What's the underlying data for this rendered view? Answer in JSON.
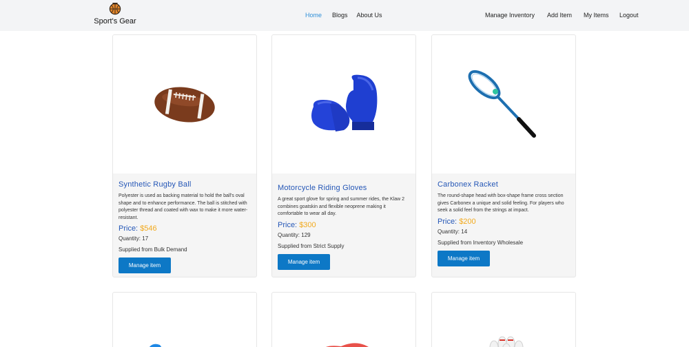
{
  "brand": {
    "name": "Sport's Gear"
  },
  "nav": {
    "center": [
      {
        "label": "Home",
        "active": true
      },
      {
        "label": "Blogs",
        "active": false
      },
      {
        "label": "About Us",
        "active": false
      }
    ],
    "right": [
      {
        "label": "Manage Inventory"
      },
      {
        "label": "Add Item"
      },
      {
        "label": "My Items"
      },
      {
        "label": "Logout"
      }
    ]
  },
  "colors": {
    "accent": "#0d78c6",
    "title": "#2456b6",
    "price": "#f2a91c",
    "nav_active": "#2f8fd8",
    "navbar_bg": "#f3f4f6"
  },
  "products": [
    {
      "name": "Synthetic Rugby Ball",
      "image_icon": "rugby-ball-image",
      "description": "Polyester is used as backing material to hold the ball's oval shape and to enhance performance. The ball is stitched with polyester thread and coated with wax to make it more water-resistant.",
      "price_label": "Price:",
      "price": "$546",
      "quantity": "Quantity: 17",
      "supplier": "Supplied from Bulk Demand",
      "button": "Manage item"
    },
    {
      "name": "Motorcycle Riding Gloves",
      "image_icon": "boxing-gloves-image",
      "description": "A great sport glove for spring and summer rides, the Klaw 2 combines goatskin and flexible neoprene making it comfortable to wear all day.",
      "price_label": "Price:",
      "price": "$300",
      "quantity": "Quantity: 129",
      "supplier": "Supplied from Strict Supply",
      "button": "Manage item"
    },
    {
      "name": "Carbonex Racket",
      "image_icon": "tennis-racket-image",
      "description": "The round-shape head with box-shape frame cross section gives Carbonex a unique and solid feeling. For players who seek a solid feel from the strings at impact.",
      "price_label": "Price:",
      "price": "$200",
      "quantity": "Quantity: 14",
      "supplier": "Supplied from Inventory Wholesale",
      "button": "Manage item"
    }
  ]
}
